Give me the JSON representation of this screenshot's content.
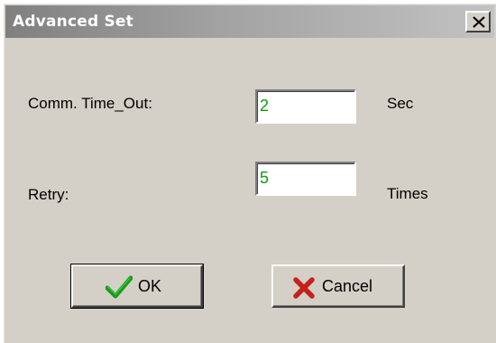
{
  "window": {
    "title": "Advanced Set",
    "close_label": "close"
  },
  "fields": {
    "comm_timeout": {
      "label": "Comm. Time_Out:",
      "value": "2",
      "unit": "Sec"
    },
    "retry": {
      "label": "Retry:",
      "value": "5",
      "unit": "Times"
    }
  },
  "buttons": {
    "ok": {
      "label": "OK",
      "icon": "checkmark-icon"
    },
    "cancel": {
      "label": "Cancel",
      "icon": "x-icon"
    }
  },
  "colors": {
    "dialog_bg": "#d4d0c8",
    "titlebar_inactive": "#808080",
    "value_text": "#139b13",
    "check_green": "#1a9a1a",
    "cancel_red": "#c8201a"
  }
}
